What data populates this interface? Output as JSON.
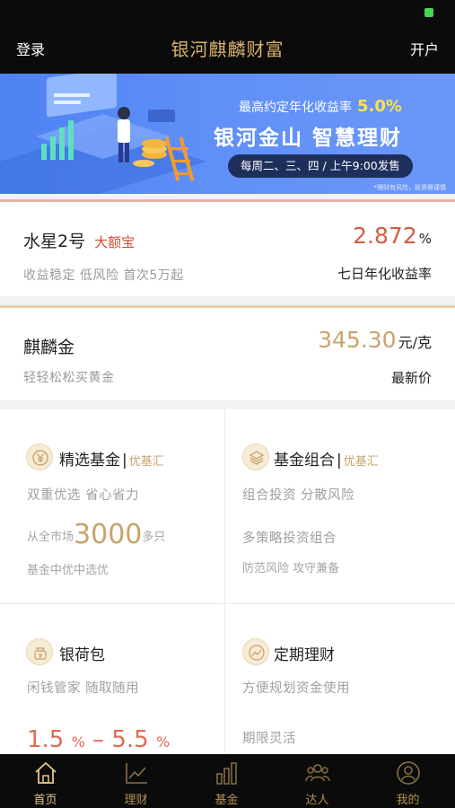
{
  "app": {
    "title": "银河麒麟财富",
    "left_action": "登录",
    "right_action": "开户"
  },
  "banner": {
    "rate_text": "最高约定年化收益率",
    "rate_value": "5.0%",
    "headline": "银河金山 智慧理财",
    "schedule": "每周二、三、四 / 上午9:00发售",
    "footnote": "*理财有风险，投资需谨慎"
  },
  "product_water": {
    "name": "水星2号",
    "tag": "大额宝",
    "desc": "收益稳定 低风险 首次5万起",
    "rate": "2.872",
    "rate_unit": "%",
    "rate_label": "七日年化收益率"
  },
  "product_gold": {
    "name": "麒麟金",
    "desc": "轻轻松松买黄金",
    "price": "345.30",
    "price_unit": "元/克",
    "price_label": "最新价"
  },
  "grid": {
    "fund": {
      "title": "精选基金",
      "sep": "|",
      "brand": "优基汇",
      "line1": "双重优选 省心省力",
      "line2_prefix": "从全市场",
      "line2_num": "3000",
      "line2_suffix": "多只",
      "line3": "基金中优中选优"
    },
    "portfolio": {
      "title": "基金组合",
      "sep": "|",
      "brand": "优基汇",
      "line1": "组合投资 分散风险",
      "line2": "多策略投资组合",
      "line3": "防范风险 攻守兼备"
    },
    "wallet": {
      "title": "银荷包",
      "line1": "闲钱管家 随取随用",
      "range_low": "1.5",
      "range_pct1": "%",
      "range_dash": "–",
      "range_high": "5.5",
      "range_pct2": "%"
    },
    "regular": {
      "title": "定期理财",
      "line1": "方便规划资金使用",
      "line2": "期限灵活"
    }
  },
  "tabs": [
    {
      "label": "首页",
      "icon": "home-icon",
      "active": true
    },
    {
      "label": "理财",
      "icon": "chart-line-icon",
      "active": false
    },
    {
      "label": "基金",
      "icon": "bar-chart-icon",
      "active": false
    },
    {
      "label": "达人",
      "icon": "people-icon",
      "active": false
    },
    {
      "label": "我的",
      "icon": "user-icon",
      "active": false
    }
  ],
  "colors": {
    "gold": "#c9a36b",
    "red": "#d55c45",
    "bar_bg": "#0b0b0b",
    "banner_blue": "#5f8ff7"
  }
}
